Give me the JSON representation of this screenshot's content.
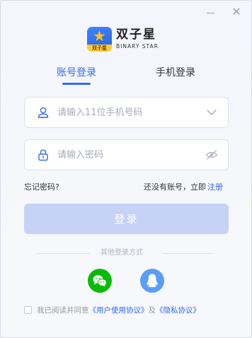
{
  "window": {
    "minimize_icon": "minimize-icon",
    "close_icon": "close-icon",
    "close_glyph": "✕"
  },
  "logo": {
    "name_cn": "双子星",
    "name_en": "BINARY STAR",
    "badge_text": "双子星",
    "star_glyph": "★"
  },
  "tabs": [
    {
      "label": "账号登录",
      "active": true
    },
    {
      "label": "手机登录",
      "active": false
    }
  ],
  "phone_field": {
    "placeholder": "请输入11位手机号码",
    "value": "",
    "icon": "user-icon",
    "trailing_icon": "chevron-down-icon"
  },
  "password_field": {
    "placeholder": "请输入密码",
    "value": "",
    "icon": "lock-icon",
    "trailing_icon": "eye-hidden-icon"
  },
  "links": {
    "forgot": "忘记密码?",
    "no_account": "还没有账号，立即",
    "register": "注册"
  },
  "login_button": {
    "label": "登录"
  },
  "other_login": {
    "label": "其他登录方式",
    "options": [
      "wechat-icon",
      "qq-icon"
    ]
  },
  "agreement": {
    "prefix": "我已阅读并同意",
    "user_agreement": "《用户使用协议》",
    "and": "及",
    "privacy": "《隐私协议》",
    "checked": false
  },
  "colors": {
    "accent": "#2f6bf0",
    "button_disabled": "#c6d3f7",
    "wechat": "#09bb07",
    "qq": "#5a9ef9"
  }
}
